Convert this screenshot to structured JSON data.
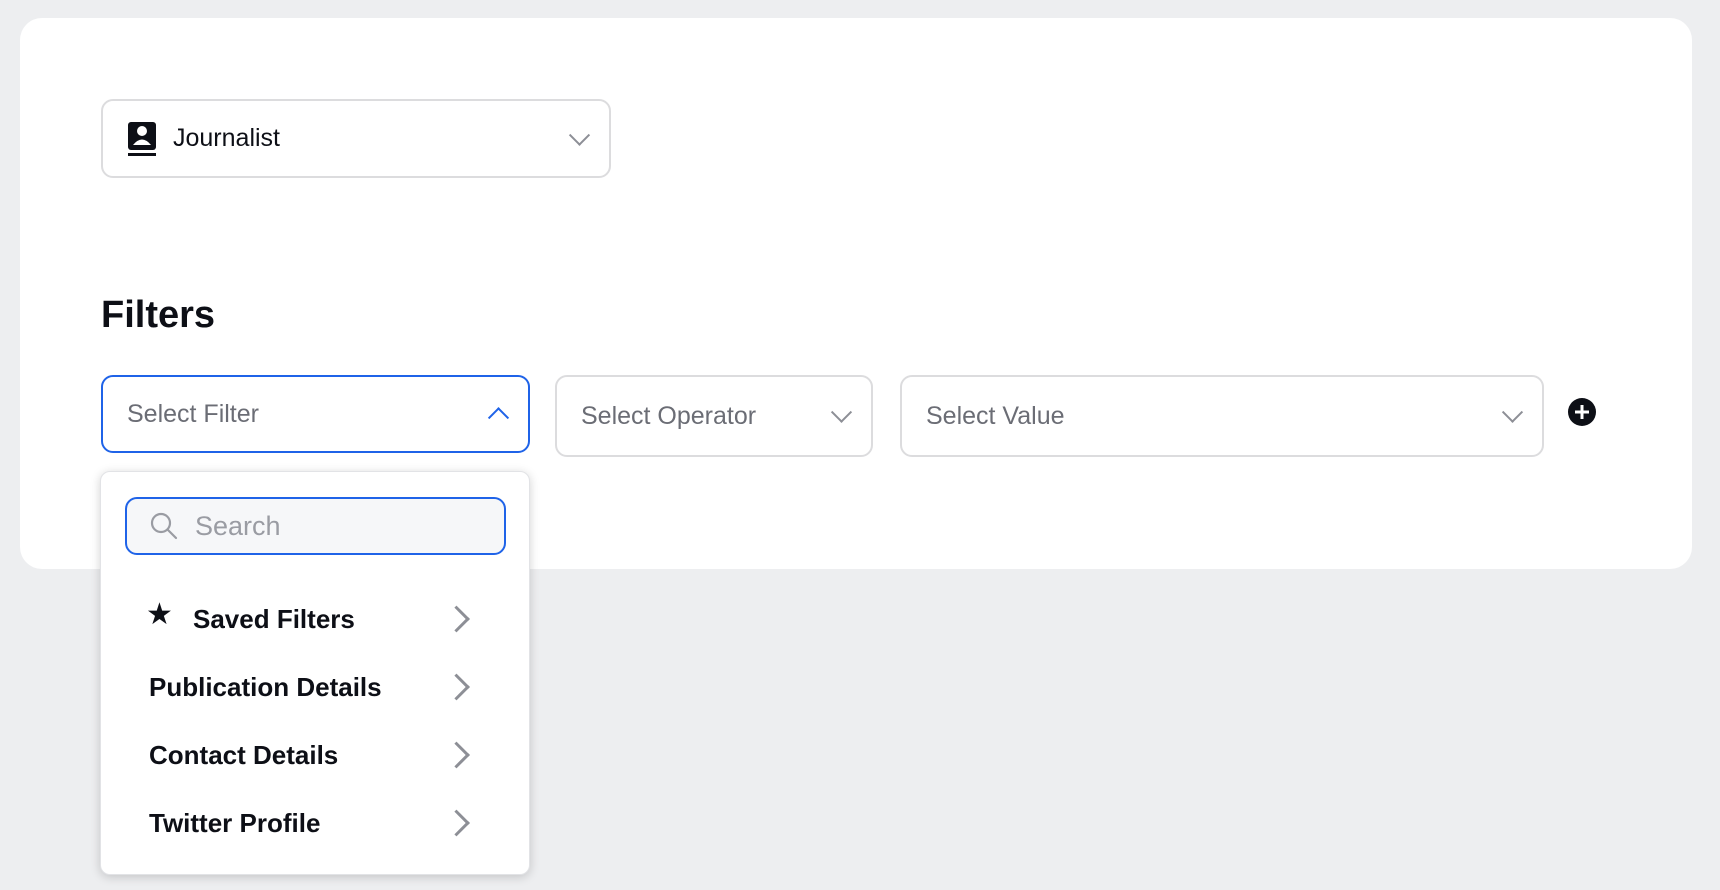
{
  "type_select": {
    "value": "Journalist",
    "icon": "contact-book-icon"
  },
  "filters": {
    "heading": "Filters",
    "filter_placeholder": "Select Filter",
    "operator_placeholder": "Select Operator",
    "value_placeholder": "Select Value",
    "add_icon": "plus-circle-icon"
  },
  "filter_menu": {
    "search_placeholder": "Search",
    "items": [
      {
        "label": "Saved Filters",
        "icon": "star-icon"
      },
      {
        "label": "Publication Details"
      },
      {
        "label": "Contact Details"
      },
      {
        "label": "Twitter Profile"
      }
    ]
  },
  "colors": {
    "accent": "#1f63e8",
    "background": "#edeef0",
    "text": "#0d0f16"
  }
}
